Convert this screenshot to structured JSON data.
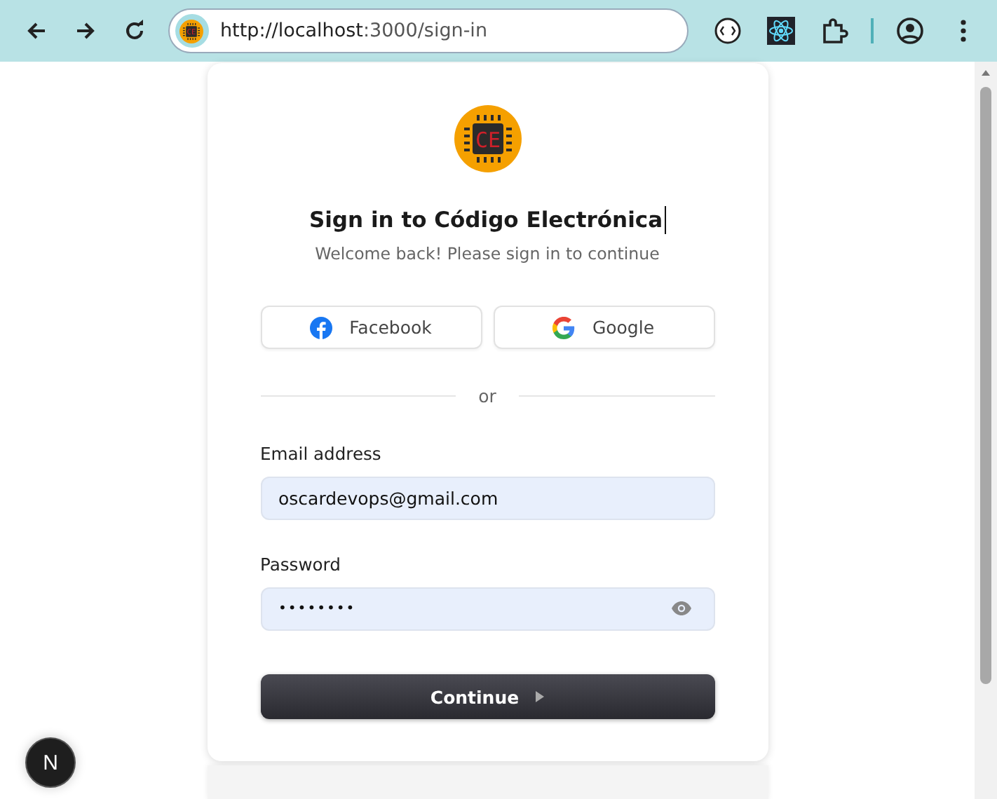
{
  "browser": {
    "url_host": "http://localhost",
    "url_rest": ":3000/sign-in",
    "favicon_text": "CE"
  },
  "sign_in": {
    "logo_text": "CE",
    "title": "Sign in to Código Electrónica",
    "subtitle": "Welcome back! Please sign in to continue",
    "social_buttons": [
      {
        "kind": "facebook",
        "label": "Facebook"
      },
      {
        "kind": "google",
        "label": "Google"
      }
    ],
    "divider": "or",
    "fields": [
      {
        "kind": "email",
        "label": "Email address",
        "value": "oscardevops@gmail.com"
      },
      {
        "kind": "password",
        "label": "Password",
        "value": "••••••••"
      }
    ],
    "submit": "Continue"
  },
  "dev_badge": "N"
}
